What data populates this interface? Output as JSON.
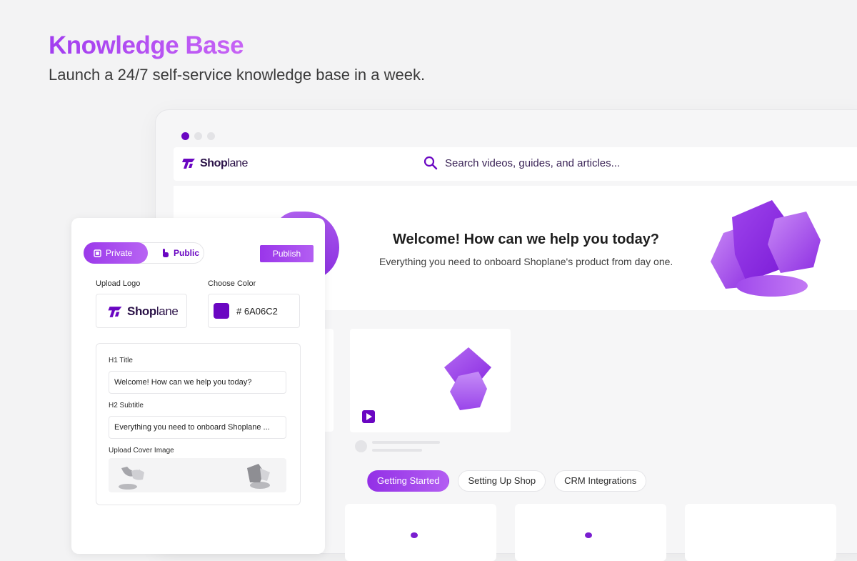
{
  "hero": {
    "title": "Knowledge Base",
    "subtitle": "Launch a 24/7 self-service knowledge base in a week."
  },
  "brand": {
    "name_bold": "Shop",
    "name_light": "lane",
    "accent_color": "#6A06C2"
  },
  "kb_header": {
    "search_placeholder": "Search videos, guides, and articles..."
  },
  "banner": {
    "title": "Welcome! How can we help you today?",
    "subtitle": "Everything you need to onboard Shoplane's product from day one."
  },
  "tabs": [
    {
      "label": "Getting Started",
      "active": true
    },
    {
      "label": "Setting Up Shop",
      "active": false
    },
    {
      "label": "CRM Integrations",
      "active": false
    }
  ],
  "editor": {
    "visibility": {
      "private_label": "Private",
      "public_label": "Public",
      "selected": "Private"
    },
    "publish_label": "Publish",
    "upload_logo_label": "Upload Logo",
    "choose_color_label": "Choose Color",
    "color_hex": "# 6A06C2",
    "h1_label": "H1 Title",
    "h1_value": "Welcome! How can we help you today?",
    "h2_label": "H2 Subtitle",
    "h2_value": "Everything you need to onboard Shoplane ...",
    "cover_label": "Upload Cover Image"
  },
  "icons": {
    "logo": "shoplane-logo-icon",
    "search": "search-icon",
    "private": "lock-icon",
    "public": "hand-pointer-icon",
    "play": "play-icon"
  }
}
